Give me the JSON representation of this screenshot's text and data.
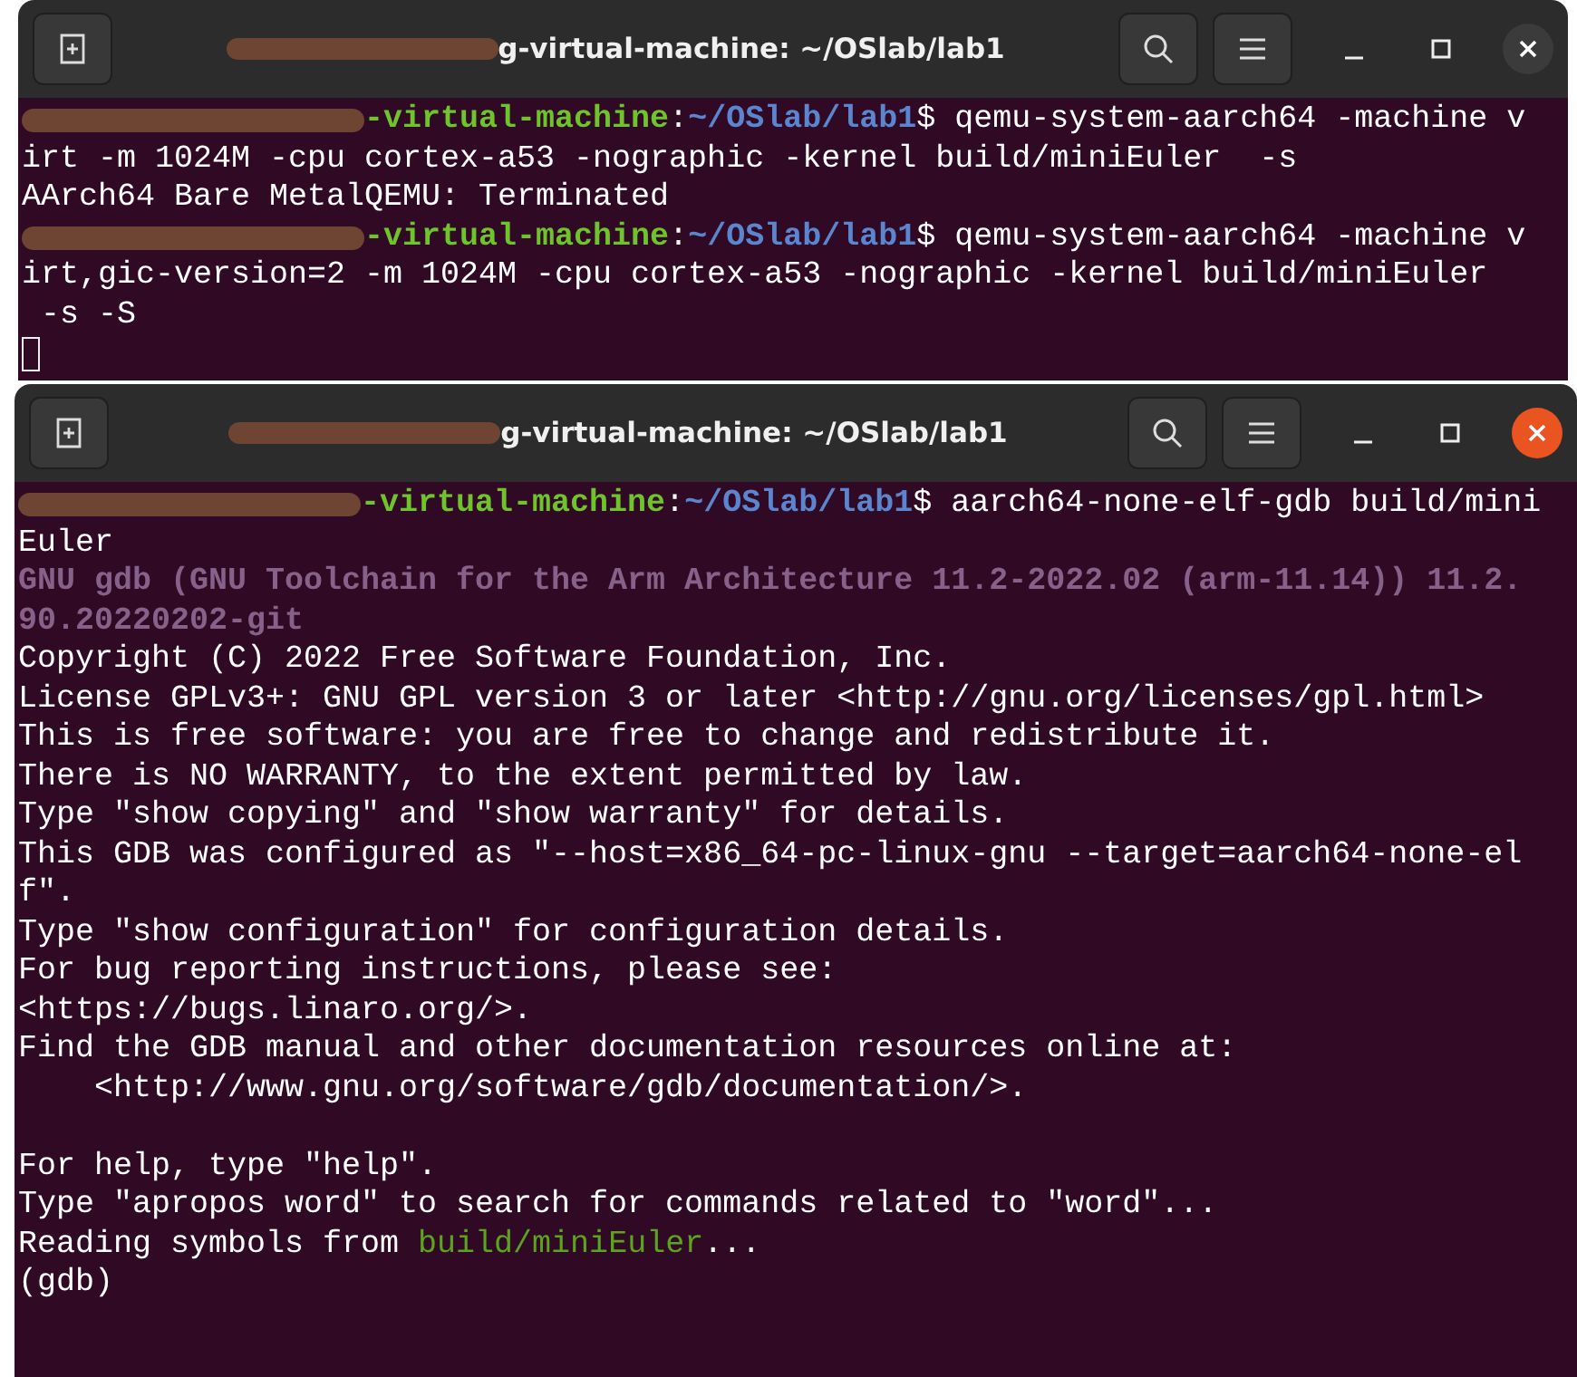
{
  "windows": [
    {
      "title": "g-virtual-machine: ~/OSlab/lab1",
      "title_redacted": true,
      "active": false,
      "cursor": true,
      "lines": [
        {
          "redacted": true,
          "segments": [
            {
              "kind": "user",
              "text": "-virtual-machine"
            },
            {
              "kind": "plain",
              "text": ":"
            },
            {
              "kind": "path",
              "text": "~/OSlab/lab1"
            },
            {
              "kind": "plain",
              "text": "$ qemu-system-aarch64 -machine v"
            }
          ]
        },
        {
          "segments": [
            {
              "kind": "plain",
              "text": "irt -m 1024M -cpu cortex-a53 -nographic -kernel build/miniEuler  -s"
            }
          ]
        },
        {
          "segments": [
            {
              "kind": "plain",
              "text": "AArch64 Bare MetalQEMU: Terminated"
            }
          ]
        },
        {
          "redacted": true,
          "segments": [
            {
              "kind": "user",
              "text": "-virtual-machine"
            },
            {
              "kind": "plain",
              "text": ":"
            },
            {
              "kind": "path",
              "text": "~/OSlab/lab1"
            },
            {
              "kind": "plain",
              "text": "$ qemu-system-aarch64 -machine v"
            }
          ]
        },
        {
          "segments": [
            {
              "kind": "plain",
              "text": "irt,gic-version=2 -m 1024M -cpu cortex-a53 -nographic -kernel build/miniEuler"
            }
          ]
        },
        {
          "segments": [
            {
              "kind": "plain",
              "text": " -s -S"
            }
          ]
        }
      ]
    },
    {
      "title": "g-virtual-machine: ~/OSlab/lab1",
      "title_redacted": true,
      "active": true,
      "cursor": false,
      "lines": [
        {
          "redacted": true,
          "segments": [
            {
              "kind": "user",
              "text": "-virtual-machine"
            },
            {
              "kind": "plain",
              "text": ":"
            },
            {
              "kind": "path",
              "text": "~/OSlab/lab1"
            },
            {
              "kind": "plain",
              "text": "$ aarch64-none-elf-gdb build/mini"
            }
          ]
        },
        {
          "segments": [
            {
              "kind": "plain",
              "text": "Euler"
            }
          ]
        },
        {
          "segments": [
            {
              "kind": "dim",
              "text": "GNU gdb (GNU Toolchain for the Arm Architecture 11.2-2022.02 (arm-11.14)) 11.2."
            }
          ]
        },
        {
          "segments": [
            {
              "kind": "dim",
              "text": "90.20220202-git"
            }
          ]
        },
        {
          "segments": [
            {
              "kind": "plain",
              "text": "Copyright (C) 2022 Free Software Foundation, Inc."
            }
          ]
        },
        {
          "segments": [
            {
              "kind": "plain",
              "text": "License GPLv3+: GNU GPL version 3 or later <http://gnu.org/licenses/gpl.html>"
            }
          ]
        },
        {
          "segments": [
            {
              "kind": "plain",
              "text": "This is free software: you are free to change and redistribute it."
            }
          ]
        },
        {
          "segments": [
            {
              "kind": "plain",
              "text": "There is NO WARRANTY, to the extent permitted by law."
            }
          ]
        },
        {
          "segments": [
            {
              "kind": "plain",
              "text": "Type \"show copying\" and \"show warranty\" for details."
            }
          ]
        },
        {
          "segments": [
            {
              "kind": "plain",
              "text": "This GDB was configured as \"--host=x86_64-pc-linux-gnu --target=aarch64-none-el"
            }
          ]
        },
        {
          "segments": [
            {
              "kind": "plain",
              "text": "f\"."
            }
          ]
        },
        {
          "segments": [
            {
              "kind": "plain",
              "text": "Type \"show configuration\" for configuration details."
            }
          ]
        },
        {
          "segments": [
            {
              "kind": "plain",
              "text": "For bug reporting instructions, please see:"
            }
          ]
        },
        {
          "segments": [
            {
              "kind": "plain",
              "text": "<https://bugs.linaro.org/>."
            }
          ]
        },
        {
          "segments": [
            {
              "kind": "plain",
              "text": "Find the GDB manual and other documentation resources online at:"
            }
          ]
        },
        {
          "segments": [
            {
              "kind": "plain",
              "text": "    <http://www.gnu.org/software/gdb/documentation/>."
            }
          ]
        },
        {
          "blank": true
        },
        {
          "segments": [
            {
              "kind": "plain",
              "text": "For help, type \"help\"."
            }
          ]
        },
        {
          "segments": [
            {
              "kind": "plain",
              "text": "Type \"apropos word\" to search for commands related to \"word\"..."
            }
          ]
        },
        {
          "segments": [
            {
              "kind": "plain",
              "text": "Reading symbols from "
            },
            {
              "kind": "file",
              "text": "build/miniEuler"
            },
            {
              "kind": "plain",
              "text": "..."
            }
          ]
        },
        {
          "segments": [
            {
              "kind": "plain",
              "text": "(gdb)"
            }
          ]
        }
      ]
    }
  ]
}
